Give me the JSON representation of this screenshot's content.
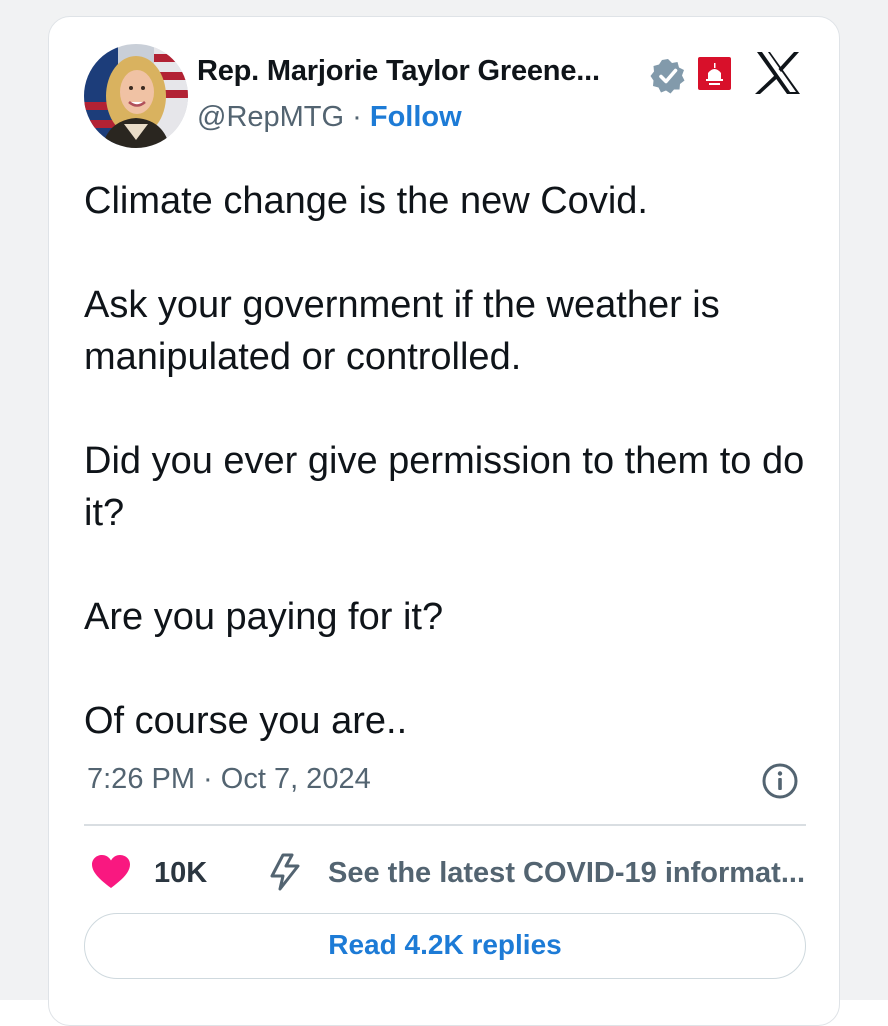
{
  "author": {
    "display_name": "Rep. Marjorie Taylor Greene...",
    "handle": "@RepMTG",
    "separator": "·",
    "follow_label": "Follow",
    "verified_color": "#829aab",
    "affiliation_color": "#d8102a"
  },
  "tweet": {
    "paragraphs": [
      "Climate change is the new Covid.",
      "Ask your government if the weather is manipulated or controlled.",
      "Did you ever give permission to them to do it?",
      "Are you paying for it?",
      "Of course you are.."
    ],
    "timestamp": "7:26 PM · Oct 7, 2024"
  },
  "actions": {
    "like_count": "10K",
    "covid_info": "See the latest COVID-19 informat...",
    "read_replies": "Read 4.2K replies"
  },
  "icons": {
    "avatar": "profile-photo",
    "verified": "verified-badge-icon",
    "affiliation": "capitol-gop-icon",
    "platform": "x-logo-icon",
    "info": "info-icon",
    "like": "heart-icon",
    "covid": "lightning-bolt-icon"
  },
  "colors": {
    "accent": "#1d7bd6",
    "heart": "#f91880",
    "secondary_text": "#536471"
  }
}
